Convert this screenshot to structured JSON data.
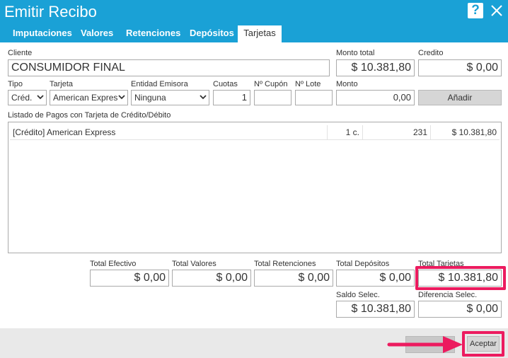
{
  "window": {
    "title": "Emitir Recibo"
  },
  "tabs": [
    "Imputaciones",
    "Valores",
    "Retenciones",
    "Depósitos",
    "Tarjetas"
  ],
  "cliente": {
    "label": "Cliente",
    "value": "CONSUMIDOR FINAL"
  },
  "monto_total": {
    "label": "Monto total",
    "value": "$ 10.381,80"
  },
  "credito": {
    "label": "Credito",
    "value": "$ 0,00"
  },
  "form": {
    "tipo": {
      "label": "Tipo",
      "value": "Créd."
    },
    "tarjeta": {
      "label": "Tarjeta",
      "value": "American Expres"
    },
    "entidad": {
      "label": "Entidad Emisora",
      "value": "Ninguna"
    },
    "cuotas": {
      "label": "Cuotas",
      "value": "1"
    },
    "cupon": {
      "label": "Nº Cupón",
      "value": ""
    },
    "lote": {
      "label": "Nº Lote",
      "value": ""
    },
    "monto": {
      "label": "Monto",
      "value": "0,00"
    },
    "add_label": "Añadir"
  },
  "list": {
    "label": "Listado de Pagos con Tarjeta de Crédito/Débito",
    "rows": [
      {
        "desc": "[Crédito] American Express",
        "cuotas": "1 c.",
        "cupon": "231",
        "monto": "$ 10.381,80"
      }
    ]
  },
  "totals": {
    "efectivo": {
      "label": "Total Efectivo",
      "value": "$ 0,00"
    },
    "valores": {
      "label": "Total Valores",
      "value": "$ 0,00"
    },
    "retenciones": {
      "label": "Total Retenciones",
      "value": "$ 0,00"
    },
    "depositos": {
      "label": "Total Depósitos",
      "value": "$ 0,00"
    },
    "tarjetas": {
      "label": "Total Tarjetas",
      "value": "$ 10.381,80"
    },
    "saldo": {
      "label": "Saldo Selec.",
      "value": "$ 10.381,80"
    },
    "diferencia": {
      "label": "Diferencia Selec.",
      "value": "$ 0,00"
    }
  },
  "footer": {
    "accept_label": "Aceptar"
  },
  "colors": {
    "header": "#1aa1d6",
    "highlight": "#ec1b5f",
    "footer": "#e9e9e9"
  },
  "icons": {
    "help": "help-icon",
    "close": "close-icon",
    "arrow": "arrow-right-icon"
  }
}
